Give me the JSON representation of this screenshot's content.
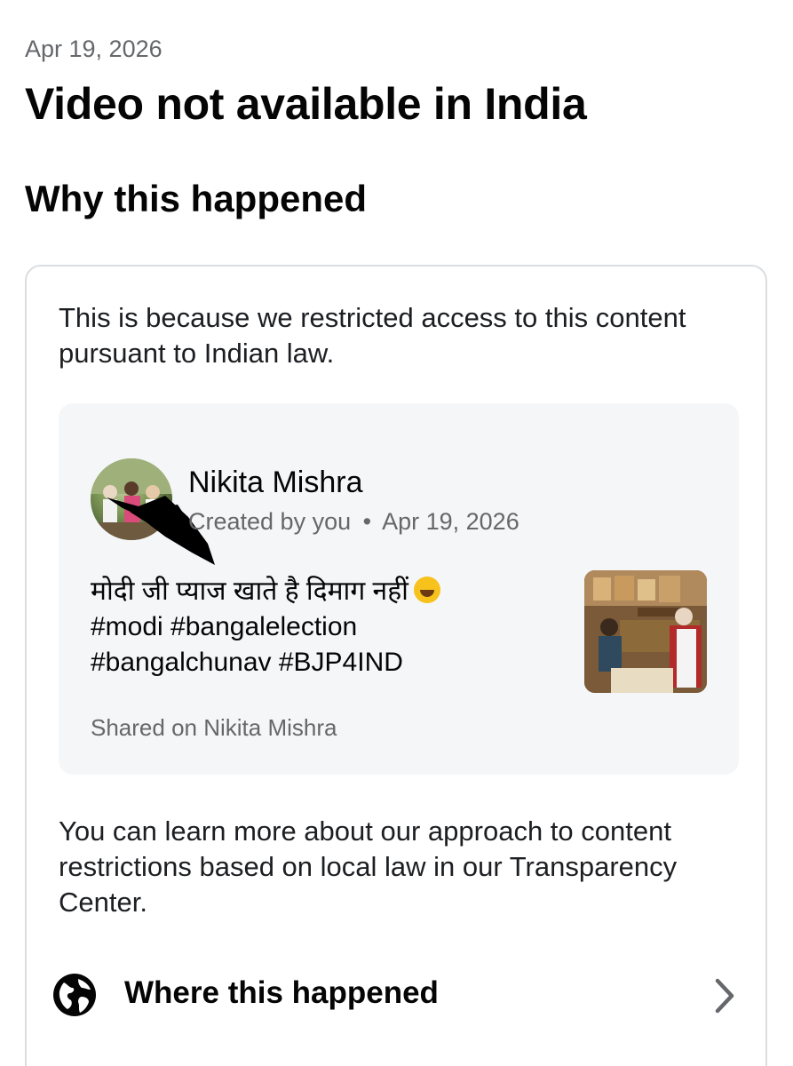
{
  "header": {
    "date": "Apr 19, 2026",
    "title": "Video not available in India",
    "section_title": "Why this happened"
  },
  "card": {
    "explanation": "This is because we restricted access to this content pursuant to Indian law.",
    "post": {
      "author": "Nikita Mishra",
      "meta_prefix": "Created by you",
      "meta_separator": "•",
      "meta_date": "Apr 19, 2026",
      "caption_lines": [
        "मोदी जी प्याज खाते है दिमाग नहीं",
        "#modi #bangalelection",
        "#bangalchunav #BJP4IND"
      ],
      "emoji": "rolling-on-floor-laughing-emoji",
      "shared_on": "Shared on Nikita Mishra"
    },
    "learn_more": "You can learn more about our approach to content restrictions based on local law in our Transparency Center.",
    "where": {
      "label": "Where this happened",
      "icon": "globe-icon",
      "chevron": "chevron-right-icon"
    }
  }
}
